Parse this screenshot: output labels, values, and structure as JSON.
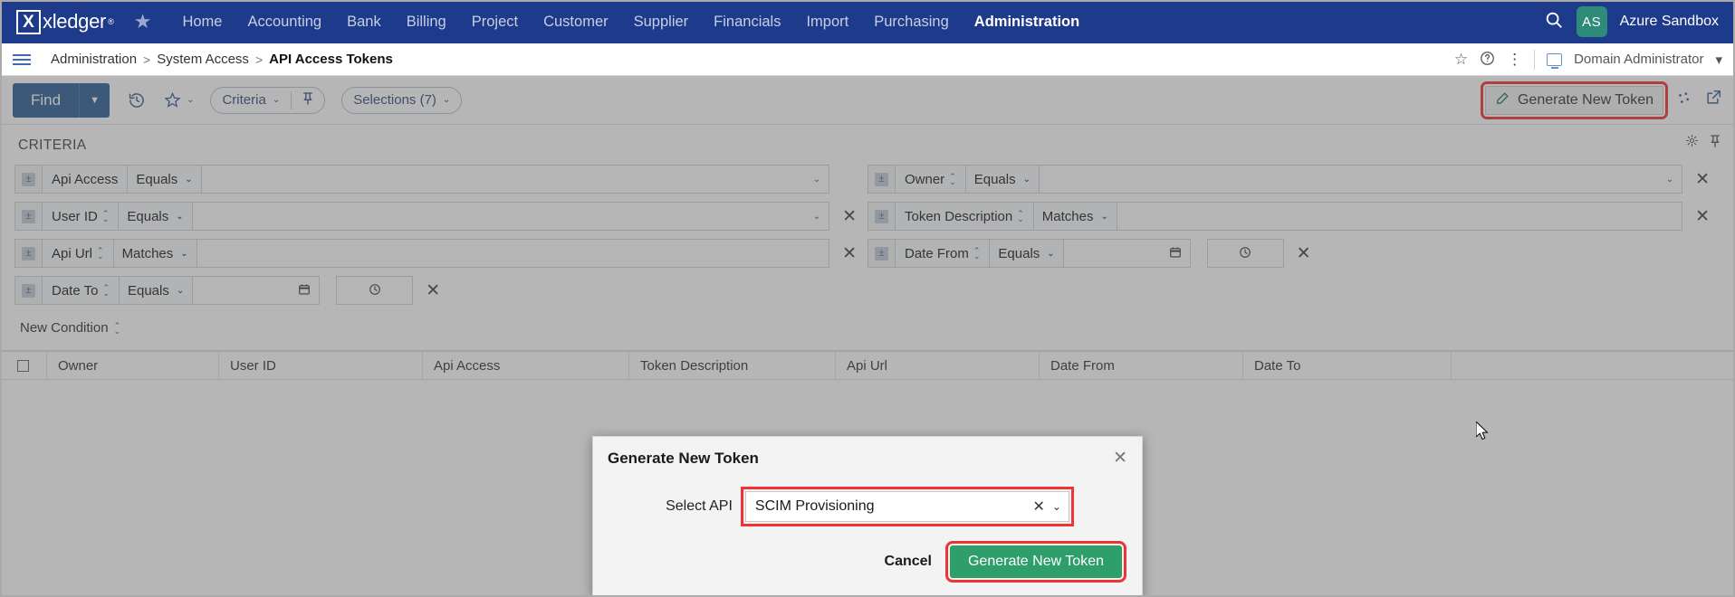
{
  "topnav": {
    "logo_text": "xledger",
    "logo_mark": "X",
    "star_icon": "star-icon",
    "links": [
      {
        "label": "Home",
        "active": false
      },
      {
        "label": "Accounting",
        "active": false
      },
      {
        "label": "Bank",
        "active": false
      },
      {
        "label": "Billing",
        "active": false
      },
      {
        "label": "Project",
        "active": false
      },
      {
        "label": "Customer",
        "active": false
      },
      {
        "label": "Supplier",
        "active": false
      },
      {
        "label": "Financials",
        "active": false
      },
      {
        "label": "Import",
        "active": false
      },
      {
        "label": "Purchasing",
        "active": false
      },
      {
        "label": "Administration",
        "active": true
      }
    ],
    "search_icon": "search-icon",
    "avatar_initials": "AS",
    "user_name": "Azure Sandbox",
    "brand_color": "#1e3a8a",
    "avatar_color": "#2e8b7a"
  },
  "breadcrumb": {
    "menu_icon": "hamburger-icon",
    "items": [
      "Administration",
      "System Access",
      "API Access Tokens"
    ],
    "separator": ">",
    "favorite_icon": "star-outline-icon",
    "help_icon": "help-circle-icon",
    "more_icon": "vertical-dots-icon",
    "domain_icon": "monitor-icon",
    "domain_label": "Domain Administrator",
    "domain_caret": "▾"
  },
  "toolbar": {
    "find_label": "Find",
    "find_caret": "▼",
    "history_icon": "history-icon",
    "favorite_icon": "star-icon",
    "favorite_caret": "⌄",
    "criteria_label": "Criteria",
    "criteria_caret": "⌄",
    "pin_icon": "pin-icon",
    "selections_label": "Selections (7)",
    "selections_caret": "⌄",
    "generate_token_label": "Generate New Token",
    "generate_token_icon": "edit-pencil-icon",
    "loading_icon": "loading-dots-icon",
    "popout_icon": "external-link-icon",
    "highlight_color": "#ef3434"
  },
  "criteria": {
    "heading": "CRITERIA",
    "settings_icon": "gear-icon",
    "pin_icon": "pin-icon",
    "new_condition_label": "New Condition",
    "remove_icon": "close-x-icon",
    "rows_left": [
      {
        "field": "Api Access",
        "operator": "Equals",
        "value": "",
        "has_stepper": false,
        "has_remove": false,
        "value_type": "select"
      },
      {
        "field": "User ID",
        "operator": "Equals",
        "value": "",
        "has_stepper": true,
        "has_remove": true,
        "value_type": "select"
      },
      {
        "field": "Api Url",
        "operator": "Matches",
        "value": "",
        "has_stepper": true,
        "has_remove": true,
        "value_type": "text"
      },
      {
        "field": "Date To",
        "operator": "Equals",
        "value": "",
        "has_stepper": true,
        "has_remove": true,
        "value_type": "datetime"
      }
    ],
    "rows_right": [
      {
        "field": "Owner",
        "operator": "Equals",
        "value": "",
        "has_stepper": true,
        "has_remove": true,
        "value_type": "select"
      },
      {
        "field": "Token Description",
        "operator": "Matches",
        "value": "",
        "has_stepper": true,
        "has_remove": true,
        "value_type": "text"
      },
      {
        "field": "Date From",
        "operator": "Equals",
        "value": "",
        "has_stepper": true,
        "has_remove": true,
        "value_type": "datetime"
      }
    ],
    "calendar_icon": "calendar-icon",
    "clock_icon": "clock-icon"
  },
  "table": {
    "columns": [
      "",
      "Owner",
      "User ID",
      "Api Access",
      "Token Description",
      "Api Url",
      "Date From",
      "Date To"
    ],
    "rows": []
  },
  "modal": {
    "title": "Generate New Token",
    "close_icon": "close-x-icon",
    "field_label": "Select API",
    "field_value": "SCIM Provisioning",
    "field_clear_icon": "clear-x-icon",
    "field_caret_icon": "chevron-down-icon",
    "cancel_label": "Cancel",
    "confirm_label": "Generate New Token",
    "confirm_color": "#2e9e6b",
    "highlight_color": "#ef3434"
  }
}
